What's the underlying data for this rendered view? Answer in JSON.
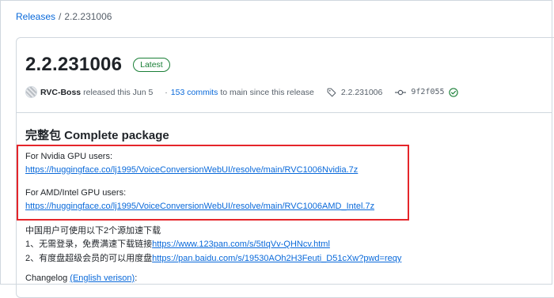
{
  "breadcrumb": {
    "link": "Releases",
    "separator": "/",
    "current": "2.2.231006"
  },
  "release": {
    "title": "2.2.231006",
    "badge": "Latest",
    "author": "RVC-Boss",
    "released_text": "released this Jun 5",
    "dot": "·",
    "commits_link": "153 commits",
    "commits_rest": "to main since this release",
    "tag": "2.2.231006",
    "commit_sha": "9f2f055",
    "icons": {
      "tag": "tag-icon",
      "commit": "commit-icon",
      "verified": "check-circle-icon"
    }
  },
  "body": {
    "heading": "完整包 Complete package",
    "nvidia_label": "For Nvidia GPU users:",
    "nvidia_link": "https://huggingface.co/lj1995/VoiceConversionWebUI/resolve/main/RVC1006Nvidia.7z",
    "amd_label": "For AMD/Intel GPU users:",
    "amd_link": "https://huggingface.co/lj1995/VoiceConversionWebUI/resolve/main/RVC1006AMD_Intel.7z",
    "cn_intro": "中国用户可使用以下2个源加速下载",
    "cn_line1_text": "1、无需登录，免费满速下载链接",
    "cn_line1_link": "https://www.123pan.com/s/5tIqVv-QHNcv.html",
    "cn_line2_text": "2、有度盘超级会员的可以用度盘",
    "cn_line2_link": "https://pan.baidu.com/s/19530AOh2H3Feuti_D51cXw?pwd=reqy",
    "changelog_label": "Changelog",
    "changelog_link": "(English verison)",
    "changelog_colon": ":"
  },
  "colors": {
    "link": "#0969da",
    "highlight_border": "#e5252a",
    "latest_badge": "#1a7f37"
  }
}
